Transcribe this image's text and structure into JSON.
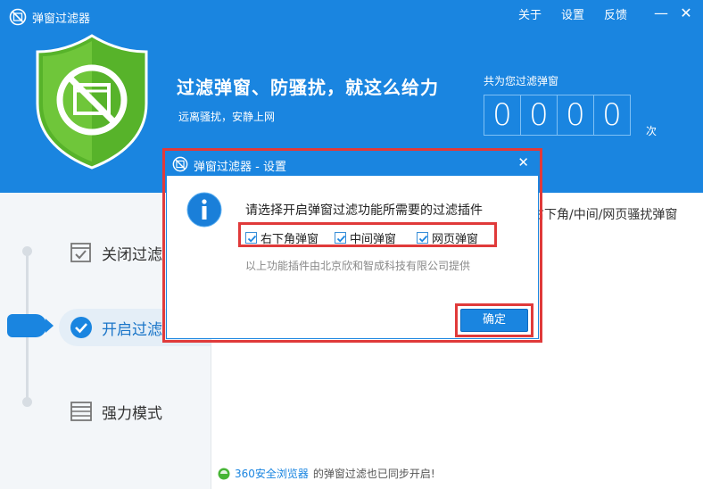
{
  "app": {
    "title": "弹窗过滤器"
  },
  "menu": {
    "about": "关于",
    "settings": "设置",
    "feedback": "反馈"
  },
  "window_controls": {
    "minimize": "—",
    "close": "✕"
  },
  "hero": {
    "slogan": "过滤弹窗、防骚扰，就这么给力",
    "subslogan": "远离骚扰，安静上网",
    "counter_label": "共为您过滤弹窗",
    "counter_digits": [
      "0",
      "0",
      "0",
      "0"
    ],
    "counter_unit": "次"
  },
  "modes": [
    {
      "label": "关闭过滤",
      "icon": "checklist-icon",
      "selected": false
    },
    {
      "label": "开启过滤",
      "icon": "check-circle-icon",
      "selected": true
    },
    {
      "label": "强力模式",
      "icon": "window-stack-icon",
      "selected": false
    }
  ],
  "panel": {
    "description": "右下角/中间/网页骚扰弹窗"
  },
  "footer": {
    "brand": "360安全浏览器",
    "text": "的弹窗过滤也已同步开启!"
  },
  "dialog": {
    "title": "弹窗过滤器 - 设置",
    "close": "✕",
    "question": "请选择开启弹窗过滤功能所需要的过滤插件",
    "options": [
      {
        "label": "右下角弹窗",
        "checked": true
      },
      {
        "label": "中间弹窗",
        "checked": true
      },
      {
        "label": "网页弹窗",
        "checked": true
      }
    ],
    "provider": "以上功能插件由北京欣和智成科技有限公司提供",
    "ok_label": "确定"
  },
  "colors": {
    "brand_blue": "#1a85e0",
    "shield_green": "#5cb82a",
    "highlight_red": "#e03a3a"
  }
}
